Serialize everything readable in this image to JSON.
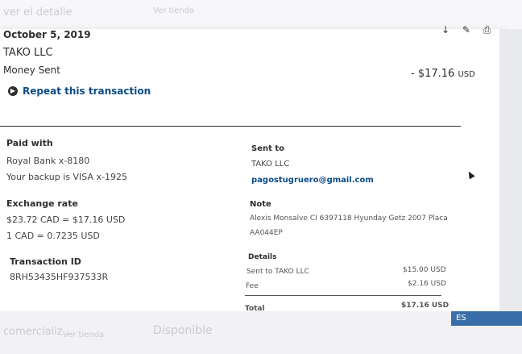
{
  "background": {
    "top_left_text": "ver el detalle",
    "top_mid_text": "Ver tienda",
    "bottom_left_text": "comercializ...",
    "bottom_left_extra": "Ver tienda",
    "bottom_mid_text": "Disponible"
  },
  "transaction": {
    "date": "October 5, 2019",
    "merchant": "TAKO LLC",
    "type": "Money Sent",
    "amount": "- $17.16",
    "currency": "USD",
    "repeat_label": "Repeat this transaction"
  },
  "left_col": {
    "paid_with": {
      "label": "Paid with",
      "line1": "Royal Bank x-8180",
      "line2": "Your backup is VISA x-1925"
    },
    "exchange": {
      "label": "Exchange rate",
      "line1": "$23.72 CAD = $17.16 USD",
      "line2": "1 CAD = 0.7235 USD"
    },
    "tx_id": {
      "label": "Transaction ID",
      "value": "8RH53435HF937533R"
    }
  },
  "right_col": {
    "sent_to": {
      "label": "Sent to",
      "name": "TAKO LLC",
      "email": "pagostugruero@gmail.com"
    },
    "note": {
      "label": "Note",
      "line1": "Alexis Monsalve CI 6397118 Hyunday Getz 2007 Placa",
      "line2": "AA044EP"
    },
    "details": {
      "label": "Details",
      "rows": [
        {
          "name": "Sent to TAKO LLC",
          "amount": "$15.00 USD"
        },
        {
          "name": "Fee",
          "amount": "$2.16 USD"
        }
      ],
      "total_label": "Total",
      "total_amount": "$17.16 USD"
    }
  },
  "taskbar": {
    "lang": "ES"
  }
}
